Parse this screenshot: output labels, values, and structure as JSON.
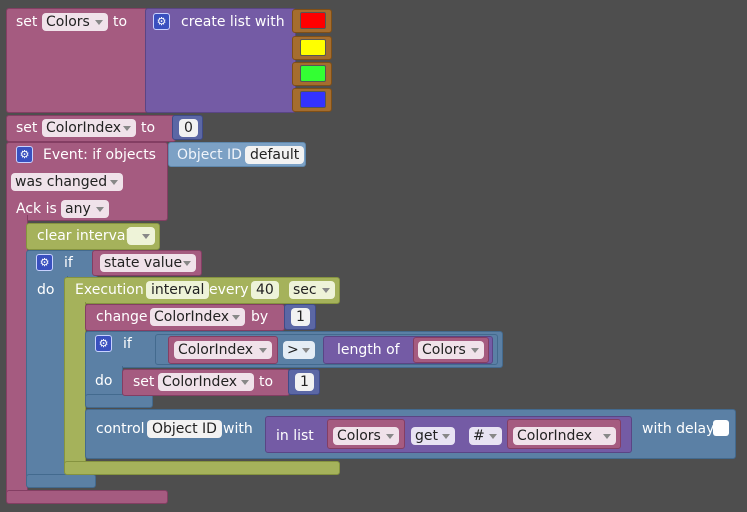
{
  "set_colors": {
    "set": "set",
    "var": "Colors",
    "to": "to",
    "create_list": "create list with"
  },
  "swatches": [
    "#ff0000",
    "#ffff00",
    "#33ff33",
    "#3333ff"
  ],
  "set_index": {
    "set": "set",
    "var": "ColorIndex",
    "to": "to",
    "value": "0"
  },
  "event": {
    "title": "Event: if objects",
    "object_label": "Object ID",
    "object_value": "default",
    "condition": "was changed",
    "ack_label": "Ack is",
    "ack_value": "any"
  },
  "clear_interval": {
    "label": "clear interval",
    "value": ""
  },
  "if_state": {
    "if": "if",
    "do": "do",
    "condition": "state value"
  },
  "execution": {
    "label": "Execution",
    "var": "interval",
    "every": "every",
    "value": "40",
    "unit": "sec"
  },
  "change": {
    "label": "change",
    "var": "ColorIndex",
    "by": "by",
    "value": "1"
  },
  "inner_if": {
    "if": "if",
    "do": "do",
    "var": "ColorIndex",
    "op": ">",
    "length_of": "length of",
    "list": "Colors"
  },
  "inner_set": {
    "set": "set",
    "var": "ColorIndex",
    "to": "to",
    "value": "1"
  },
  "control": {
    "label": "control",
    "object": "Object ID",
    "with": "with",
    "in_list": "in list",
    "list": "Colors",
    "get": "get",
    "hash": "#",
    "var": "ColorIndex",
    "with_delay": "with delay"
  }
}
